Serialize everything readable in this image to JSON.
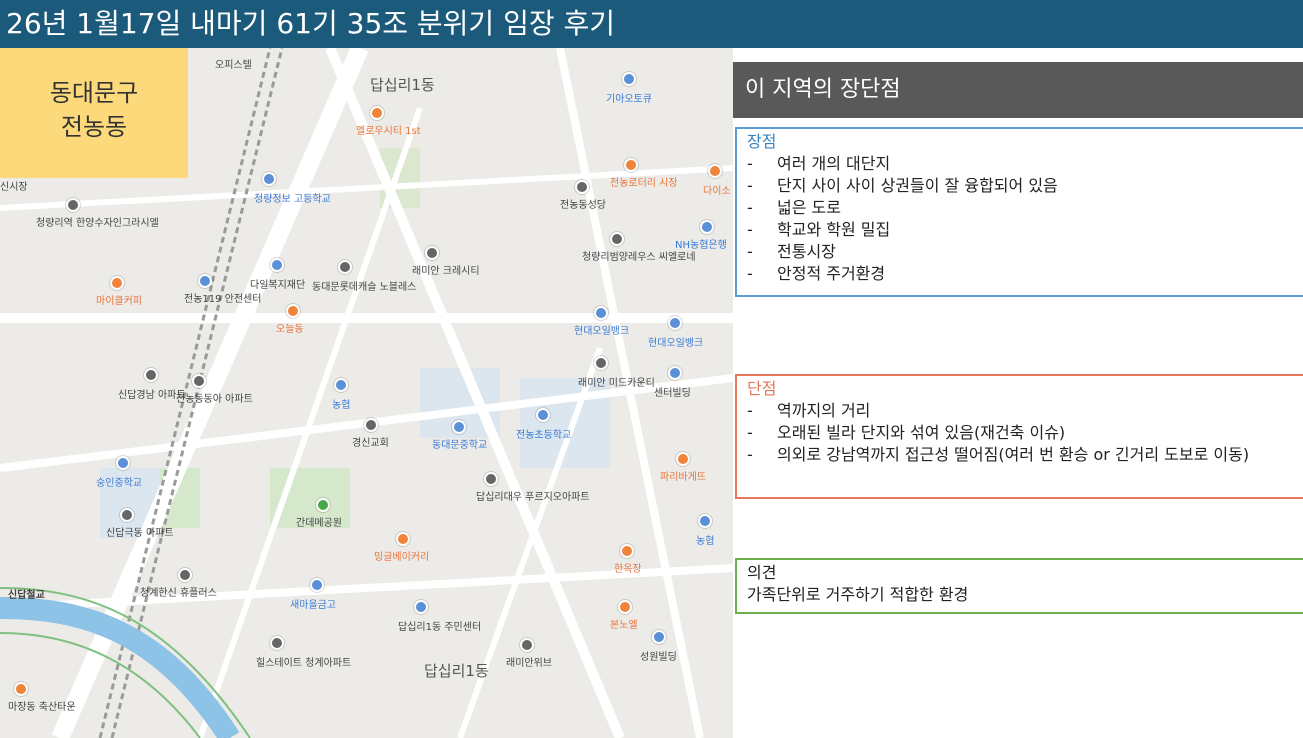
{
  "slide": {
    "title": "26년 1월17일 내마기 61기 35조 분위기 임장 후기"
  },
  "region": {
    "line1": "동대문구",
    "line2": "전농동"
  },
  "panel": {
    "header": "이 지역의 장단점",
    "pros": {
      "title": "장점",
      "items": [
        "여러 개의 대단지",
        "단지 사이 사이 상권들이 잘 융합되어 있음",
        "넓은 도로",
        "학교와 학원 밀집",
        "전통시장",
        "안정적 주거환경"
      ]
    },
    "cons": {
      "title": "단점",
      "items": [
        "역까지의 거리",
        "오래된 빌라 단지와 섞여 있음(재건축 이슈)",
        "의외로 강남역까지 접근성 떨어짐(여러 번 환승 or 긴거리 도보로 이동)"
      ]
    },
    "opinion": {
      "title": "의견",
      "text": "가족단위로 거주하기 적합한 환경"
    }
  },
  "map_labels": {
    "l1": "오피스텔",
    "l2": "답십리1동",
    "l3": "기아오토큐",
    "l4": "멜로우시티 1st",
    "l5": "전농로터리 시장",
    "l6": "다이소",
    "l7": "전농동성당",
    "l8": "청량정보 고등학교",
    "l9": "청량리역 한양수자인그라시엘",
    "l10": "NH농협은행",
    "l11": "청량리범양레우스 씨엘로네",
    "l12": "래미안 크레시티",
    "l13": "다일복지재단",
    "l14": "동대문롯데캐슬 노블레스",
    "l15": "마이클커피",
    "l16": "전농119 안전센터",
    "l17": "오늘동",
    "l18": "현대오일뱅크",
    "l19": "현대오일뱅크",
    "l20": "래미안 미드카운티",
    "l21": "센터빌딩",
    "l22": "신답경남 아파트",
    "l23": "전농동동아 아파트",
    "l24": "농협",
    "l25": "경신교회",
    "l26": "동대문중학교",
    "l27": "전농초등학교",
    "l28": "숭인중학교",
    "l29": "파리바게뜨",
    "l30": "답십리대우 푸르지오아파트",
    "l31": "간데메공원",
    "l32": "농협",
    "l33": "신답극동 아파트",
    "l34": "밍글베이커리",
    "l35": "한옥장",
    "l36": "신답철교",
    "l37": "청계한신 휴플러스",
    "l38": "새마을금고",
    "l39": "답십리1동 주민센터",
    "l40": "본노엘",
    "l41": "힐스테이트 청계아파트",
    "l42": "답십리1동",
    "l43": "래미안위브",
    "l44": "성원빌딩",
    "l45": "마장동 축산타운",
    "l46": "신시장"
  }
}
